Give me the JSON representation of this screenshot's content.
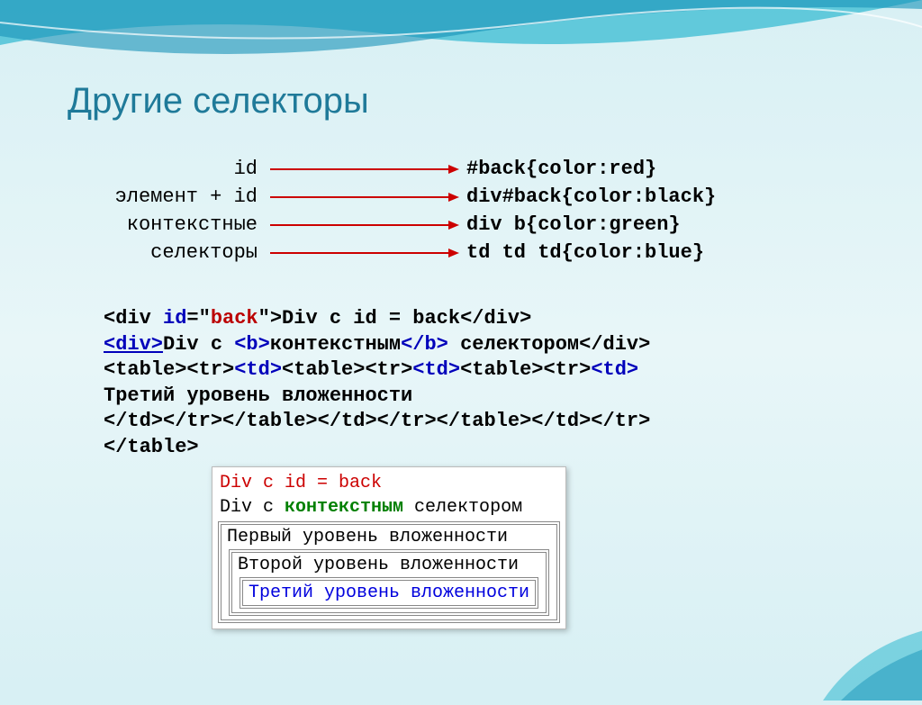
{
  "title": "Другие селекторы",
  "mappings": [
    {
      "label": "id",
      "rule": "#back{color:red}"
    },
    {
      "label": "элемент + id",
      "rule": "div#back{color:black}"
    },
    {
      "label": "контекстные",
      "rule": "div b{color:green}"
    },
    {
      "label": "селекторы",
      "rule": "td td td{color:blue}"
    }
  ],
  "code": {
    "l1_a": "<div ",
    "l1_b": "id",
    "l1_c": "=\"",
    "l1_d": "back",
    "l1_e": "\">Div с id = back</div>",
    "l2_a": "<div>",
    "l2_b": "Div с ",
    "l2_c": "<b>",
    "l2_d": "контекстным",
    "l2_e": "</b>",
    "l2_f": " селектором</div>",
    "l3": "<table><tr><td><table><tr><td><table><tr><td>",
    "l4": "Третий уровень вложенности",
    "l5": "</td></tr></table></td></tr></table></td></tr>",
    "l6": "</table>"
  },
  "result": {
    "line1": "Div с id = back",
    "line2_a": "Div с ",
    "line2_b": "контекстным",
    "line2_c": " селектором",
    "nest1": "Первый уровень вложенности",
    "nest2": "Второй уровень вложенности",
    "nest3": "Третий уровень вложенности"
  }
}
